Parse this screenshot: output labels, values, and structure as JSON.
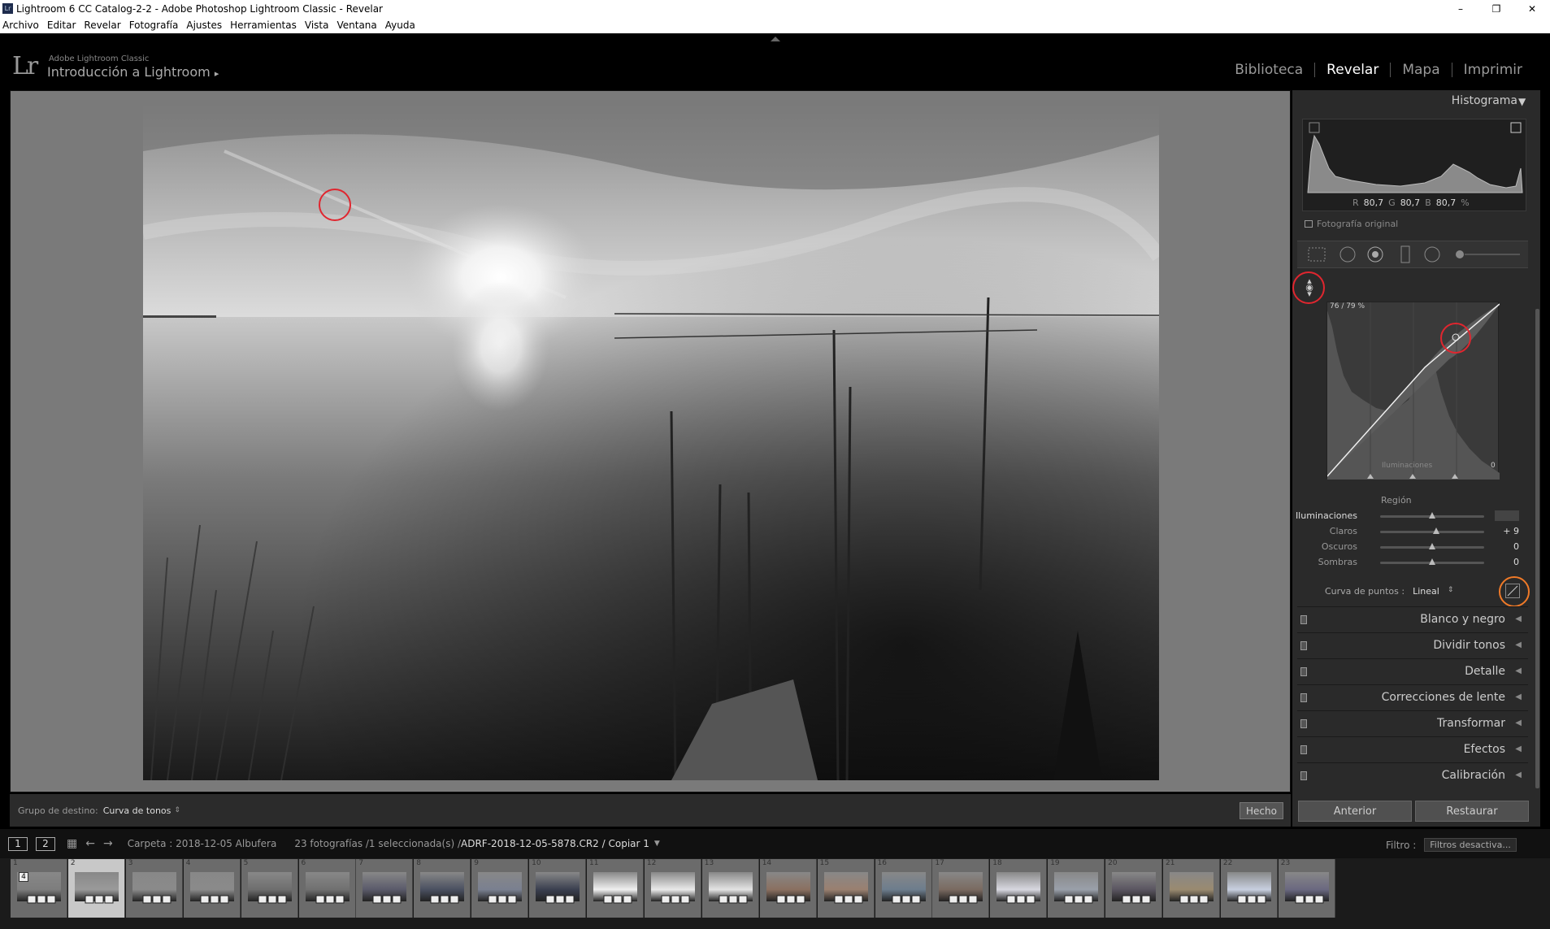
{
  "window": {
    "title": "Lightroom 6 CC Catalog-2-2 - Adobe Photoshop Lightroom Classic - Revelar",
    "app_icon": "Lr",
    "minimize": "–",
    "maximize": "❐",
    "close": "✕"
  },
  "menu": [
    "Archivo",
    "Editar",
    "Revelar",
    "Fotografía",
    "Ajustes",
    "Herramientas",
    "Vista",
    "Ventana",
    "Ayuda"
  ],
  "identity": {
    "logo": "Lr",
    "brand_small": "Adobe Lightroom Classic",
    "brand_large": "Introducción a Lightroom",
    "arrow": "▸"
  },
  "modules": [
    {
      "label": "Biblioteca",
      "active": false
    },
    {
      "label": "Revelar",
      "active": true
    },
    {
      "label": "Mapa",
      "active": false
    },
    {
      "label": "Imprimir",
      "active": false
    }
  ],
  "toolbar": {
    "target_label": "Grupo de destino:",
    "target_value": "Curva de tonos",
    "done": "Hecho"
  },
  "right_panel": {
    "histogram_title": "Histograma",
    "histogram_arrow": "▼",
    "rgb": {
      "r_label": "R",
      "r": "80,7",
      "g_label": "G",
      "g": "80,7",
      "b_label": "B",
      "b": "80,7",
      "unit": "%"
    },
    "original_photo": "Fotografía original",
    "curve_readout": "76 / 79 %",
    "curve_region_label": "Iluminaciones",
    "curve_zero": "0",
    "region_title": "Región",
    "sliders": [
      {
        "label": "Iluminaciones",
        "value": "0",
        "pos": 0.5,
        "active": true
      },
      {
        "label": "Claros",
        "value": "+ 9",
        "pos": 0.54,
        "active": false
      },
      {
        "label": "Oscuros",
        "value": "0",
        "pos": 0.5,
        "active": false
      },
      {
        "label": "Sombras",
        "value": "0",
        "pos": 0.5,
        "active": false
      }
    ],
    "point_curve_label": "Curva de puntos :",
    "point_curve_value": "Lineal",
    "sections": [
      "Blanco y negro",
      "Dividir tonos",
      "Detalle",
      "Correcciones de lente",
      "Transformar",
      "Efectos",
      "Calibración"
    ],
    "prev_button": "Anterior",
    "reset_button": "Restaurar"
  },
  "filmstrip_header": {
    "view1": "1",
    "view2": "2",
    "folder": "Carpeta : 2018-12-05 Albufera",
    "count": "23 fotografías /1 seleccionada(s) /",
    "filename": "ADRF-2018-12-05-5878.CR2 / Copiar 1",
    "filter_label": "Filtro :",
    "filter_value": "Filtros desactiva..."
  },
  "filmstrip": {
    "selected_index": 1,
    "stack_badge": "4",
    "cells": [
      {
        "n": "1",
        "tone": "#7d7d7d"
      },
      {
        "n": "2",
        "tone": "#9a9a9a"
      },
      {
        "n": "3",
        "tone": "#8a8a8a"
      },
      {
        "n": "4",
        "tone": "#8a8a8a"
      },
      {
        "n": "5",
        "tone": "#6e6e6e"
      },
      {
        "n": "6",
        "tone": "#707070"
      },
      {
        "n": "7",
        "tone": "#5a5a6a"
      },
      {
        "n": "8",
        "tone": "#4a5060"
      },
      {
        "n": "9",
        "tone": "#7a8090"
      },
      {
        "n": "10",
        "tone": "#3a3f4f"
      },
      {
        "n": "11",
        "tone": "#f0f0f0"
      },
      {
        "n": "12",
        "tone": "#eaeaea"
      },
      {
        "n": "13",
        "tone": "#e4e4e4"
      },
      {
        "n": "14",
        "tone": "#8a7060"
      },
      {
        "n": "15",
        "tone": "#9a8070"
      },
      {
        "n": "16",
        "tone": "#6d7d8d"
      },
      {
        "n": "17",
        "tone": "#7a6a60"
      },
      {
        "n": "18",
        "tone": "#d8d8e0"
      },
      {
        "n": "19",
        "tone": "#9aa0aa"
      },
      {
        "n": "20",
        "tone": "#5a5560"
      },
      {
        "n": "21",
        "tone": "#9a8a70"
      },
      {
        "n": "22",
        "tone": "#c8d0e0"
      },
      {
        "n": "23",
        "tone": "#6a6880"
      }
    ]
  },
  "colors": {
    "highlight_red": "#e0262f",
    "highlight_orange": "#f07a28"
  }
}
